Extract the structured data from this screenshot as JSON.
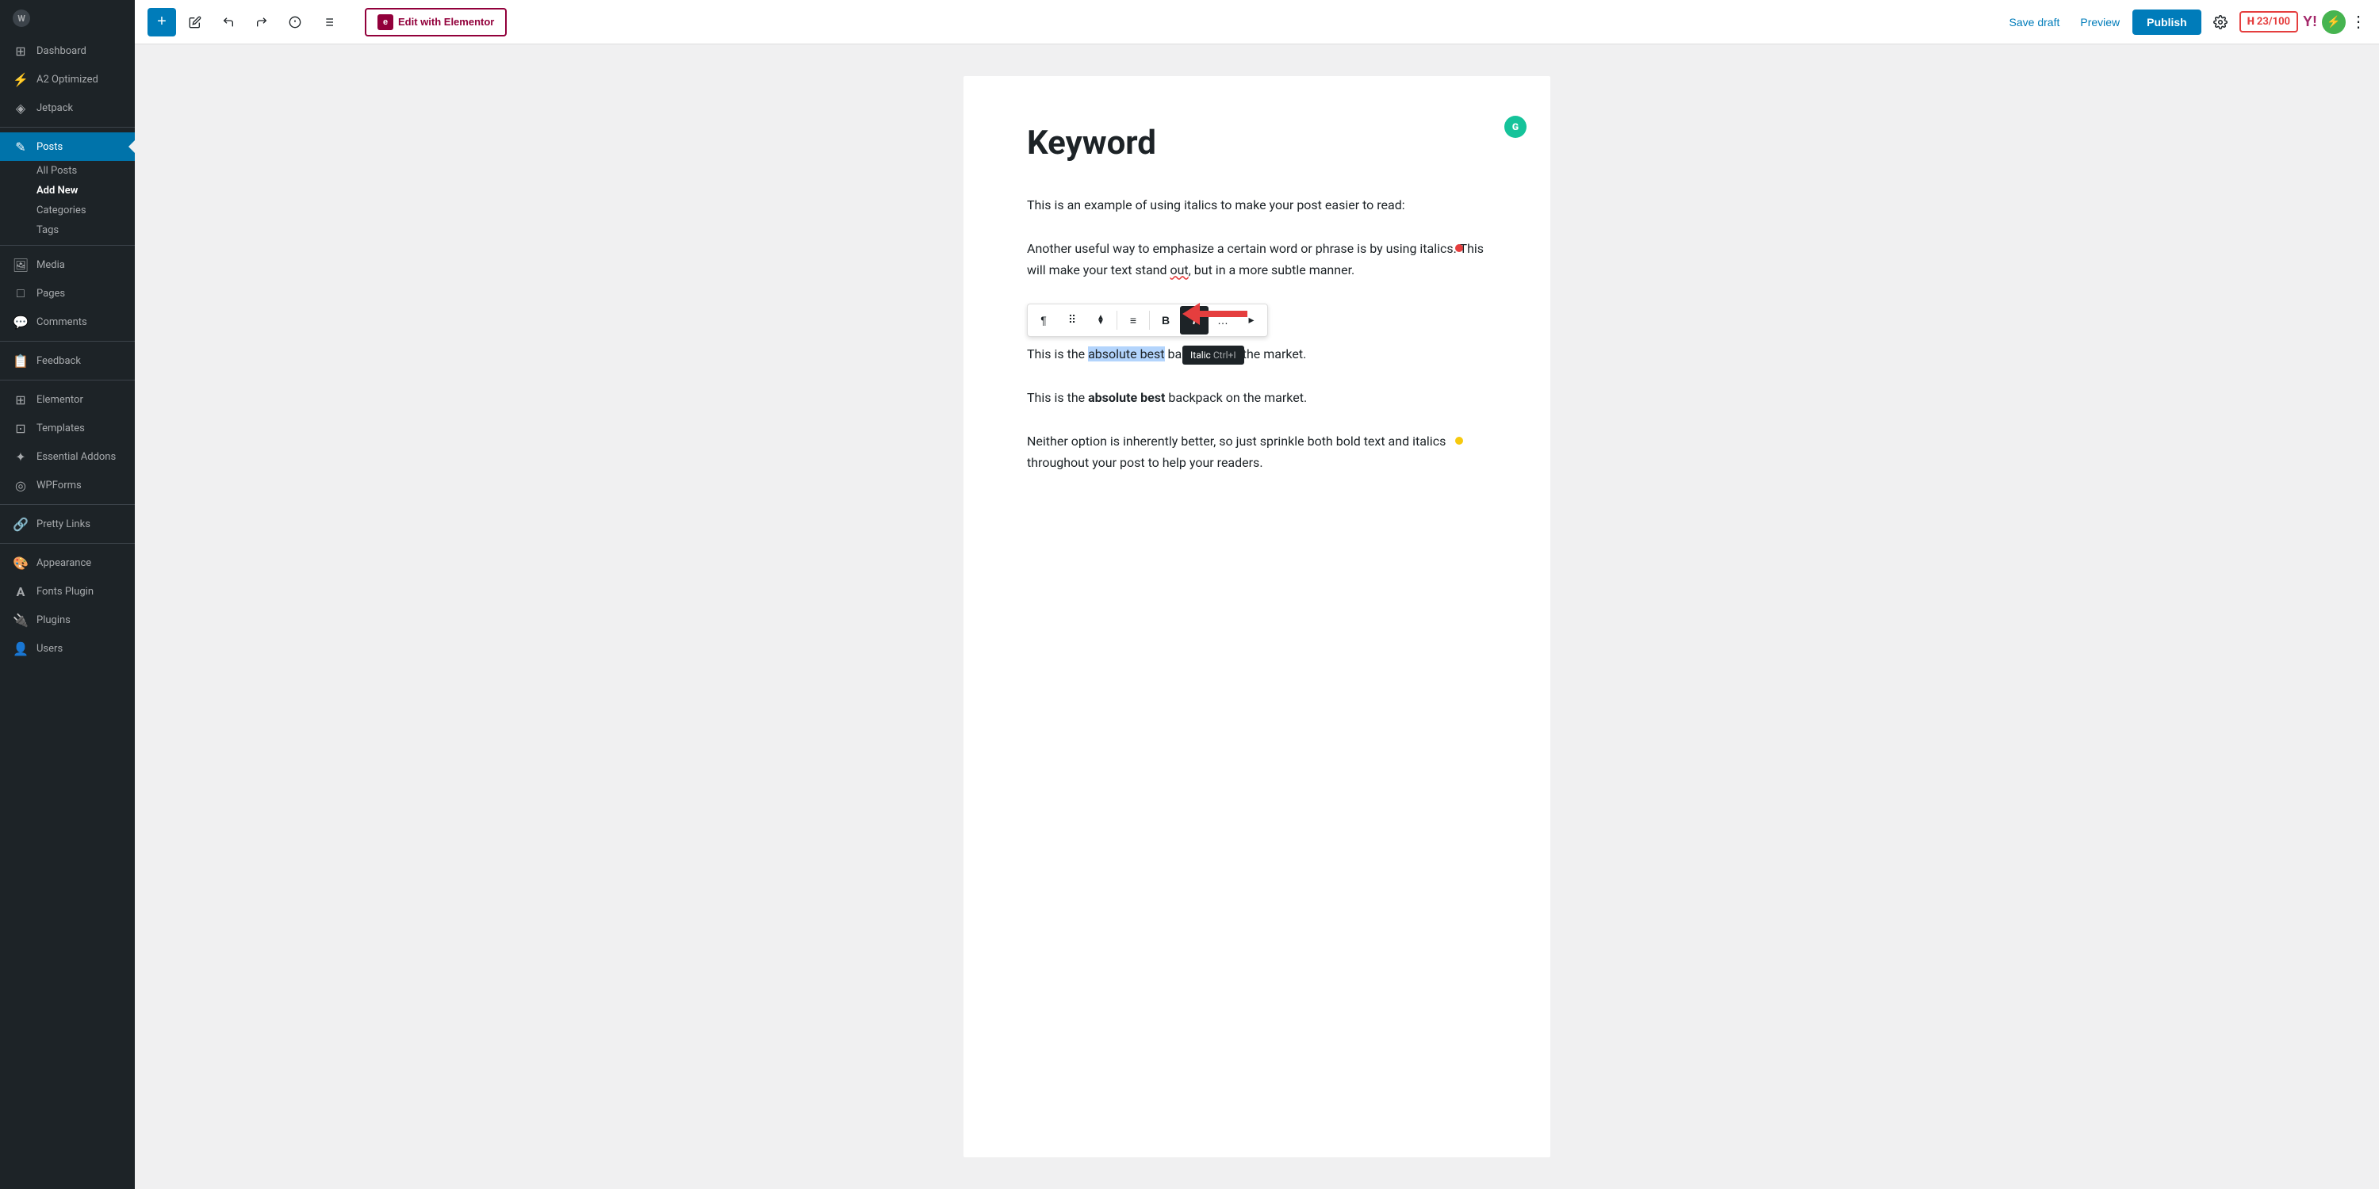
{
  "sidebar": {
    "items": [
      {
        "id": "dashboard",
        "label": "Dashboard",
        "icon": "⊞"
      },
      {
        "id": "a2optimized",
        "label": "A2 Optimized",
        "icon": "⚡"
      },
      {
        "id": "jetpack",
        "label": "Jetpack",
        "icon": "⬡"
      },
      {
        "id": "posts",
        "label": "Posts",
        "icon": "✎",
        "active": true
      },
      {
        "id": "media",
        "label": "Media",
        "icon": "🖼"
      },
      {
        "id": "pages",
        "label": "Pages",
        "icon": "□"
      },
      {
        "id": "comments",
        "label": "Comments",
        "icon": "💬"
      },
      {
        "id": "feedback",
        "label": "Feedback",
        "icon": "📋"
      },
      {
        "id": "elementor",
        "label": "Elementor",
        "icon": "⊞"
      },
      {
        "id": "templates",
        "label": "Templates",
        "icon": "⊡"
      },
      {
        "id": "essential-addons",
        "label": "Essential Addons",
        "icon": "✦"
      },
      {
        "id": "wpforms",
        "label": "WPForms",
        "icon": "◎"
      },
      {
        "id": "pretty-links",
        "label": "Pretty Links",
        "icon": "🔗"
      },
      {
        "id": "appearance",
        "label": "Appearance",
        "icon": "🎨"
      },
      {
        "id": "fonts-plugin",
        "label": "Fonts Plugin",
        "icon": "A"
      },
      {
        "id": "plugins",
        "label": "Plugins",
        "icon": "🔌"
      },
      {
        "id": "users",
        "label": "Users",
        "icon": "👤"
      }
    ],
    "sub_items": [
      {
        "id": "all-posts",
        "label": "All Posts"
      },
      {
        "id": "add-new",
        "label": "Add New",
        "active": true
      },
      {
        "id": "categories",
        "label": "Categories"
      },
      {
        "id": "tags",
        "label": "Tags"
      }
    ]
  },
  "toolbar": {
    "add_label": "+",
    "edit_elementor_label": "Edit with Elementor",
    "save_draft_label": "Save draft",
    "preview_label": "Preview",
    "publish_label": "Publish",
    "yoast_score": "23/100"
  },
  "editor": {
    "title": "Keyword",
    "paragraphs": [
      {
        "id": "p1",
        "text": "This is an example of using italics to make your post easier to read:"
      },
      {
        "id": "p2",
        "text_before": "Another useful way to emphasize a certain word or phrase is by using italics. This will make your text stand ",
        "text_underline": "out",
        "text_after": ", but in a more subtle manner.",
        "has_red_dot": true
      },
      {
        "id": "p3",
        "text_before": "This is the ",
        "text_selected": "absolute best",
        "text_after": " backpack on the market."
      },
      {
        "id": "p4",
        "text_before": "This is the ",
        "text_bold": "absolute best",
        "text_after": " backpack on the market."
      },
      {
        "id": "p5",
        "text": "Neither option is inherently better, so just sprinkle both bold text and italics throughout your post to help your readers.",
        "has_yellow_dot": true
      }
    ],
    "block_toolbar": {
      "buttons": [
        {
          "id": "paragraph",
          "icon": "¶",
          "label": "Paragraph"
        },
        {
          "id": "drag",
          "icon": "⠿",
          "label": "Drag"
        },
        {
          "id": "move",
          "icon": "⬆",
          "label": "Move up/down"
        },
        {
          "id": "align",
          "icon": "≡",
          "label": "Align"
        },
        {
          "id": "bold",
          "icon": "B",
          "label": "Bold"
        },
        {
          "id": "italic",
          "icon": "I",
          "label": "Italic",
          "active": true
        },
        {
          "id": "more1",
          "icon": "…",
          "label": "More"
        },
        {
          "id": "more2",
          "icon": "",
          "label": "More options"
        }
      ],
      "tooltip": {
        "label": "Italic",
        "shortcut": "Ctrl+I"
      }
    }
  }
}
